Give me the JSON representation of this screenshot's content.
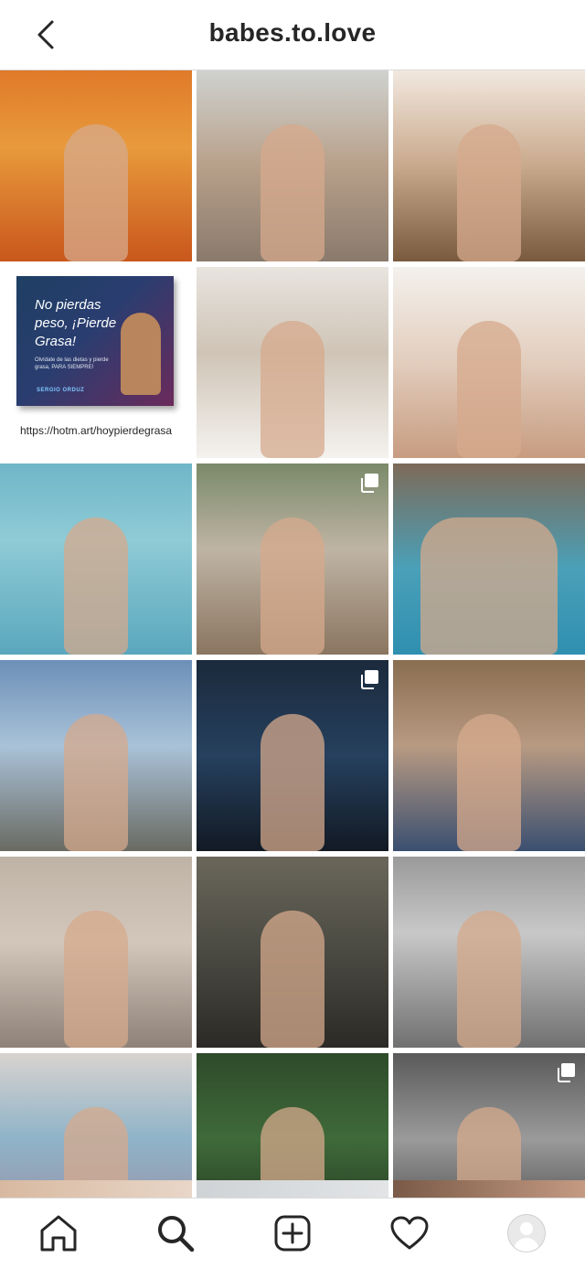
{
  "header": {
    "title": "babes.to.love",
    "back_icon": "chevron-left-icon"
  },
  "promo": {
    "book_title": "No pierdas peso, ¡Pierde Grasa!",
    "book_subtitle": "Olvídate de las dietas y pierde grasa, PARA SIEMPRE!",
    "book_author": "SERGIO ORDUZ",
    "link": "https://hotm.art/hoypierdegrasa"
  },
  "grid": {
    "tiles": [
      {
        "kind": "photo",
        "bg": "linear-gradient(180deg,#e07a2a 0%,#e89a3c 40%,#c9571c 100%)",
        "fig": "single",
        "multi": false
      },
      {
        "kind": "photo",
        "bg": "linear-gradient(180deg,#cfd2cf 0%,#b8a08a 50%,#8a7a6c 100%)",
        "fig": "single",
        "multi": false
      },
      {
        "kind": "photo",
        "bg": "linear-gradient(180deg,#f2e8df 0%,#c9a98c 50%,#7a5a3e 100%)",
        "fig": "single",
        "multi": false
      },
      {
        "kind": "promo"
      },
      {
        "kind": "photo",
        "bg": "linear-gradient(180deg,#e8e4df 0%,#cfc4b6 45%,#f4f2ef 100%)",
        "fig": "single",
        "multi": false
      },
      {
        "kind": "photo",
        "bg": "linear-gradient(180deg,#f4f1ed 0%,#e2cdbd 50%,#c79c80 100%)",
        "fig": "single",
        "multi": false
      },
      {
        "kind": "photo",
        "bg": "linear-gradient(180deg,#6fb6c8 0%,#8fcbd6 40%,#5aa7bd 100%)",
        "fig": "single",
        "multi": false
      },
      {
        "kind": "photo",
        "bg": "linear-gradient(180deg,#7a8a6a 0%,#bfb4a4 45%,#8a7560 100%)",
        "fig": "single",
        "multi": true
      },
      {
        "kind": "photo",
        "bg": "linear-gradient(180deg,#7d6a58 0%,#4aa0b8 55%,#2f8fb0 100%)",
        "fig": "pair",
        "multi": false
      },
      {
        "kind": "photo",
        "bg": "linear-gradient(180deg,#6c8fb8 0%,#a9c2d8 45%,#6a6a62 100%)",
        "fig": "single",
        "multi": false
      },
      {
        "kind": "photo",
        "bg": "linear-gradient(180deg,#1b2a3c 0%,#26405e 50%,#121a24 100%)",
        "fig": "single",
        "multi": true
      },
      {
        "kind": "photo",
        "bg": "linear-gradient(180deg,#8a6e50 0%,#b89a82 45%,#3a4f70 100%)",
        "fig": "single",
        "multi": false
      },
      {
        "kind": "photo",
        "bg": "linear-gradient(180deg,#bfb3a6 0%,#d3c7bc 45%,#8e8278 100%)",
        "fig": "single",
        "multi": false
      },
      {
        "kind": "photo",
        "bg": "linear-gradient(180deg,#6a665a 0%,#4a4a42 50%,#2c2a26 100%)",
        "fig": "single",
        "multi": false
      },
      {
        "kind": "photo",
        "bg": "linear-gradient(180deg,#9a9a9a 0%,#c8c8c8 40%,#707070 100%)",
        "fig": "single",
        "multi": false
      },
      {
        "kind": "photo",
        "bg": "linear-gradient(180deg,#d8d3cf 0%,#8fb3c8 45%,#9a8a9e 100%)",
        "fig": "single",
        "multi": false
      },
      {
        "kind": "photo",
        "bg": "linear-gradient(180deg,#2e4a2a 0%,#3f6a3a 45%,#1f2e1c 100%)",
        "fig": "single",
        "multi": false
      },
      {
        "kind": "photo",
        "bg": "linear-gradient(180deg,#5a5a5a 0%,#9a9a9a 45%,#3a3a3a 100%)",
        "fig": "single",
        "multi": true
      }
    ],
    "partial_row": [
      "linear-gradient(90deg,#d8b9a0,#e8d6c8)",
      "linear-gradient(90deg,#cfd3d6,#e2e4e6)",
      "linear-gradient(90deg,#7a5a48,#c49a82)"
    ]
  },
  "tabbar": {
    "items": [
      "home-icon",
      "search-icon",
      "new-post-icon",
      "activity-heart-icon",
      "profile-avatar-icon"
    ]
  }
}
